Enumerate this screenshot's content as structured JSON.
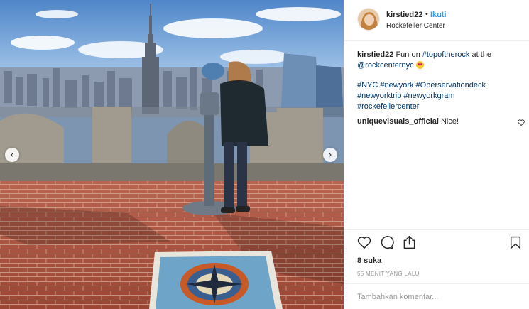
{
  "post": {
    "username": "kirstied22",
    "separator": "•",
    "follow_label": "Ikuti",
    "location": "Rockefeller Center"
  },
  "caption": {
    "username": "kirstied22",
    "text_before": "Fun on",
    "tag_topoftherock": "#topoftherock",
    "text_middle": "at the",
    "mention": "@rockcenternyc",
    "emoji": "heart-eyes-emoji",
    "hashtags": [
      "#NYC",
      "#newyork",
      "#Oberservationdeck",
      "#newyorktrip",
      "#newyorkgram",
      "#rockefellercenter"
    ]
  },
  "comment": {
    "username": "uniquevisuals_official",
    "text": "Nice!"
  },
  "actions": {
    "likes": "8 suka",
    "timestamp": "55 MENIT YANG LALU",
    "comment_placeholder": "Tambahkan komentar..."
  },
  "carousel": {
    "prev_arrow": "‹",
    "next_arrow": "›"
  },
  "colors": {
    "link_blue": "#3897f0",
    "tag_blue": "#003569",
    "text": "#262626",
    "muted": "#999999",
    "divider": "#efefef"
  }
}
